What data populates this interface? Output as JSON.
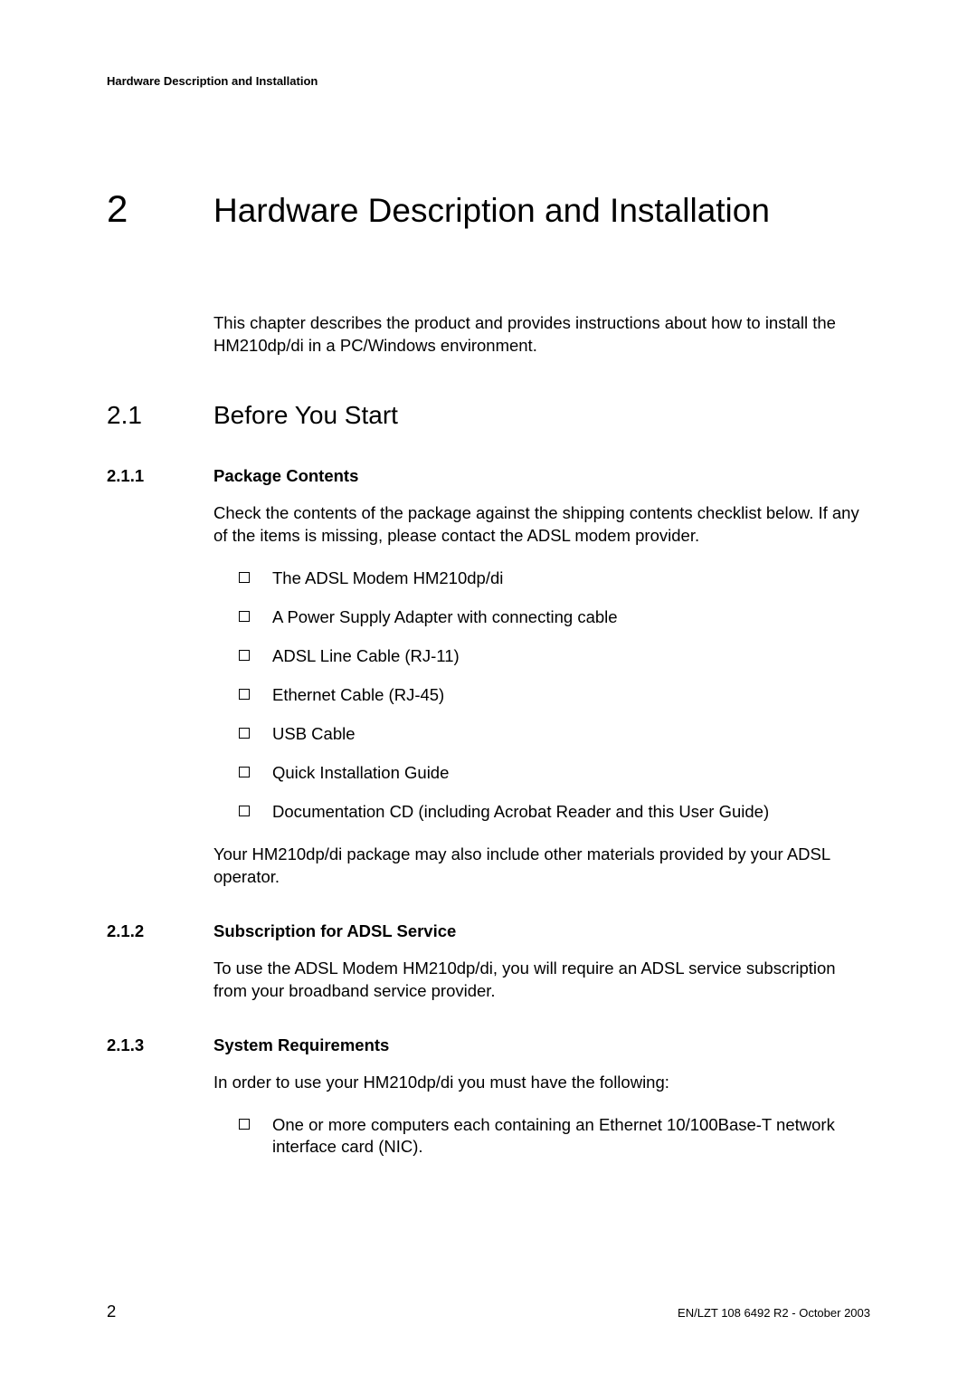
{
  "header": "Hardware Description and Installation",
  "chapter": {
    "number": "2",
    "title": "Hardware Description and Installation",
    "intro": "This chapter describes the product and provides instructions about how to install the HM210dp/di in a PC/Windows environment."
  },
  "section": {
    "number": "2.1",
    "title": "Before You Start"
  },
  "subsections": [
    {
      "number": "2.1.1",
      "title": "Package Contents",
      "intro": "Check the contents of the package against the shipping contents checklist below. If any of the items is missing, please contact the ADSL modem provider.",
      "bullets": [
        "The ADSL Modem HM210dp/di",
        "A Power Supply Adapter with connecting cable",
        "ADSL Line Cable (RJ-11)",
        "Ethernet Cable (RJ-45)",
        "USB Cable",
        "Quick Installation Guide",
        "Documentation CD (including Acrobat Reader and this User Guide)"
      ],
      "outro": "Your HM210dp/di package may also include other materials provided by your ADSL operator."
    },
    {
      "number": "2.1.2",
      "title": "Subscription for ADSL Service",
      "intro": "To use the ADSL Modem HM210dp/di, you will require an ADSL service subscription from your broadband service provider."
    },
    {
      "number": "2.1.3",
      "title": "System Requirements",
      "intro": "In order to use your HM210dp/di you must have the following:",
      "bullets": [
        "One or more computers each containing an Ethernet 10/100Base-T network interface card (NIC)."
      ]
    }
  ],
  "footer": {
    "page": "2",
    "info": "EN/LZT 108 6492 R2  - October 2003"
  }
}
